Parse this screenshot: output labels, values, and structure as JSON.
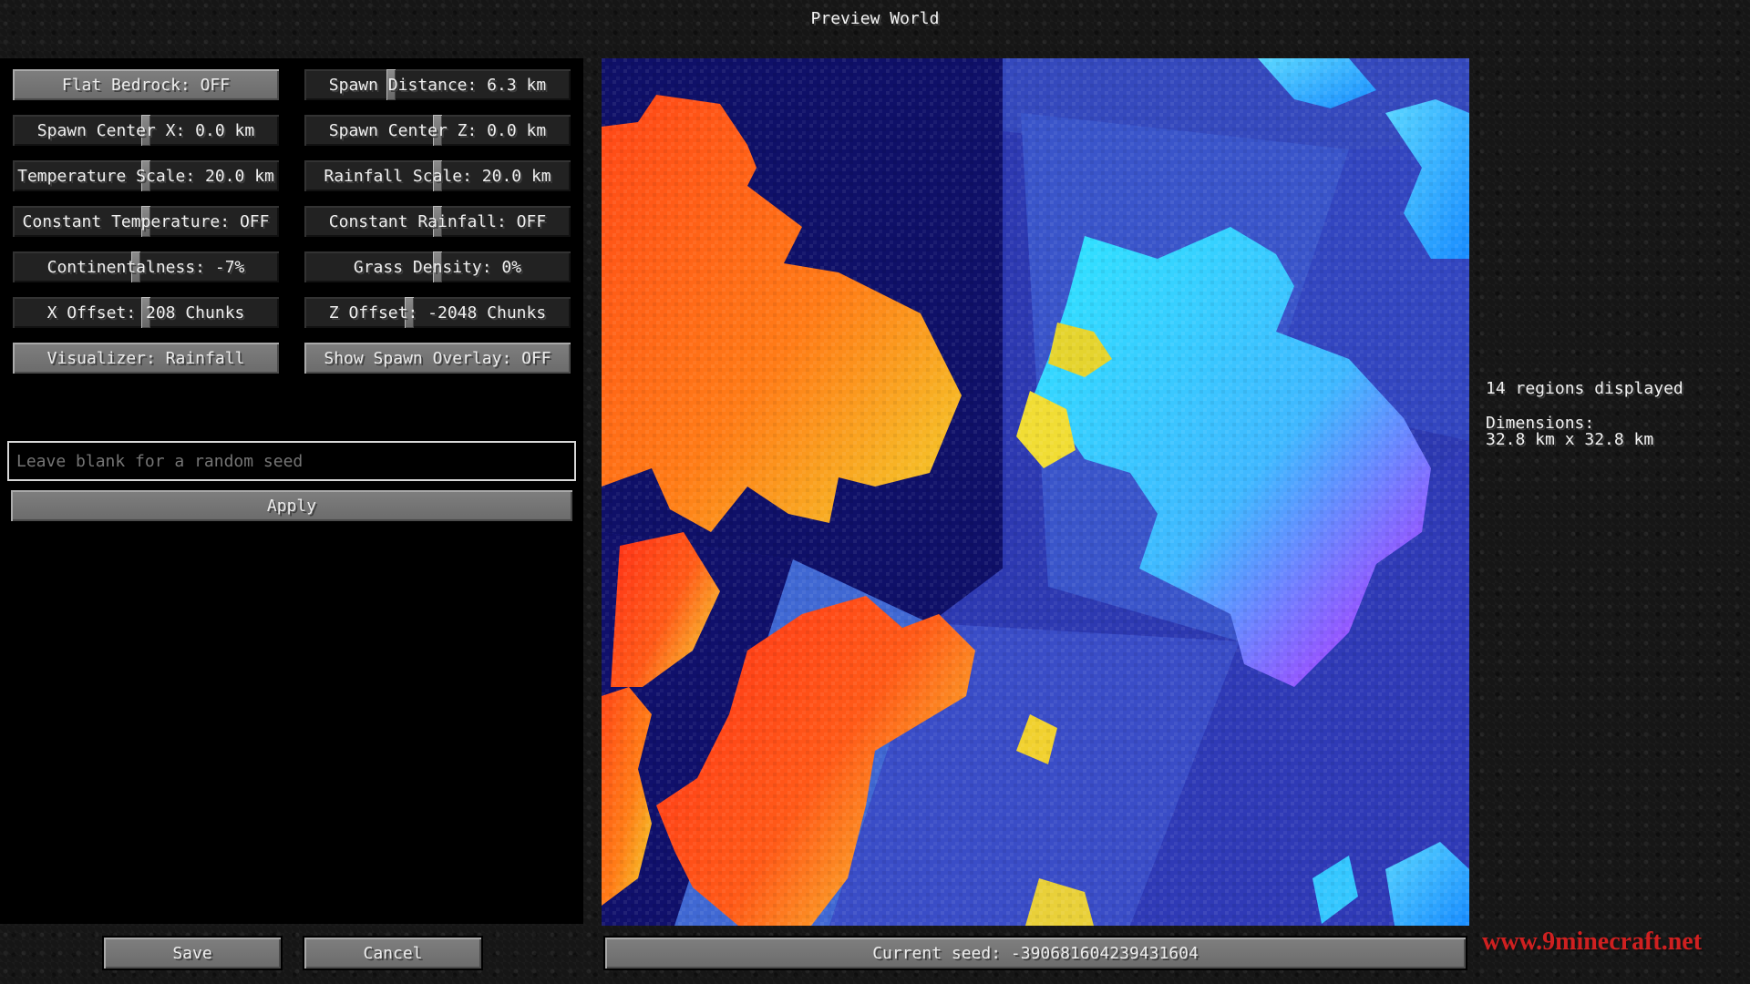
{
  "title": "Preview World",
  "controls": {
    "flat_bedrock": {
      "label": "Flat Bedrock: OFF"
    },
    "spawn_distance": {
      "label": "Spawn Distance: 6.3 km",
      "level": 0.32
    },
    "spawn_center_x": {
      "label": "Spawn Center X: 0.0 km",
      "level": 0.5
    },
    "spawn_center_z": {
      "label": "Spawn Center Z: 0.0 km",
      "level": 0.5
    },
    "temperature_scale": {
      "label": "Temperature Scale: 20.0 km",
      "level": 0.5
    },
    "rainfall_scale": {
      "label": "Rainfall Scale: 20.0 km",
      "level": 0.5
    },
    "constant_temperature": {
      "label": "Constant Temperature: OFF",
      "level": 0.5
    },
    "constant_rainfall": {
      "label": "Constant Rainfall: OFF",
      "level": 0.5
    },
    "continentalness": {
      "label": "Continentalness: -7%",
      "level": 0.46
    },
    "grass_density": {
      "label": "Grass Density: 0%",
      "level": 0.5
    },
    "x_offset": {
      "label": "X Offset: 208 Chunks",
      "level": 0.5
    },
    "z_offset": {
      "label": "Z Offset: -2048 Chunks",
      "level": 0.39
    },
    "visualizer": {
      "label": "Visualizer: Rainfall"
    },
    "show_spawn_overlay": {
      "label": "Show Spawn Overlay: OFF"
    }
  },
  "seed_input": {
    "placeholder": "Leave blank for a random seed",
    "value": ""
  },
  "apply_label": "Apply",
  "info": {
    "regions": "14 regions displayed",
    "dimensions_label": "Dimensions:",
    "dimensions_value": "32.8 km x 32.8 km"
  },
  "bottom": {
    "save_label": "Save",
    "cancel_label": "Cancel",
    "current_seed": "Current seed: -390681604239431604"
  },
  "watermark": "www.9minecraft.net",
  "colors": {
    "deep_ocean": "#0f1068",
    "ocean": "#2d39b1",
    "light_ocean": "#3f5bd7",
    "dry": "#ff3a17",
    "dry_yellow": "#f3d82a",
    "wet": "#2fd7ff",
    "very_wet": "#cf21ff"
  }
}
